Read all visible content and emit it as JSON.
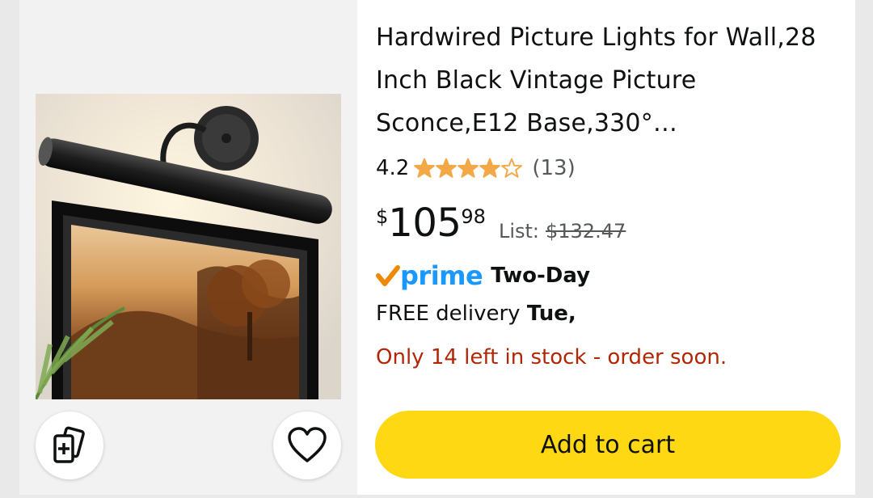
{
  "product": {
    "title": "Hardwired Picture Lights for Wall,28 Inch Black Vintage Picture Sconce,E12 Base,330°…",
    "image_icon": "picture-light-product-image",
    "rating": {
      "value": "4.2",
      "stars": 4.2,
      "count": "(13)"
    },
    "price": {
      "currency": "$",
      "whole": "105",
      "fraction": "98",
      "list_label": "List:",
      "list_price": "$132.47"
    },
    "prime": {
      "check_icon": "prime-check-icon",
      "word": "prime",
      "service": "Two-Day"
    },
    "delivery": {
      "prefix": "FREE delivery",
      "day": "Tue,"
    },
    "stock": "Only 14 left in stock - order soon."
  },
  "actions": {
    "compare_icon": "compare-cards-icon",
    "wishlist_icon": "heart-icon",
    "add_to_cart": "Add to cart"
  },
  "colors": {
    "star": "#f3a847",
    "prime_blue": "#1a98ff",
    "prime_check": "#f08804",
    "stock_red": "#b12704",
    "cart_yellow": "#ffd814"
  }
}
